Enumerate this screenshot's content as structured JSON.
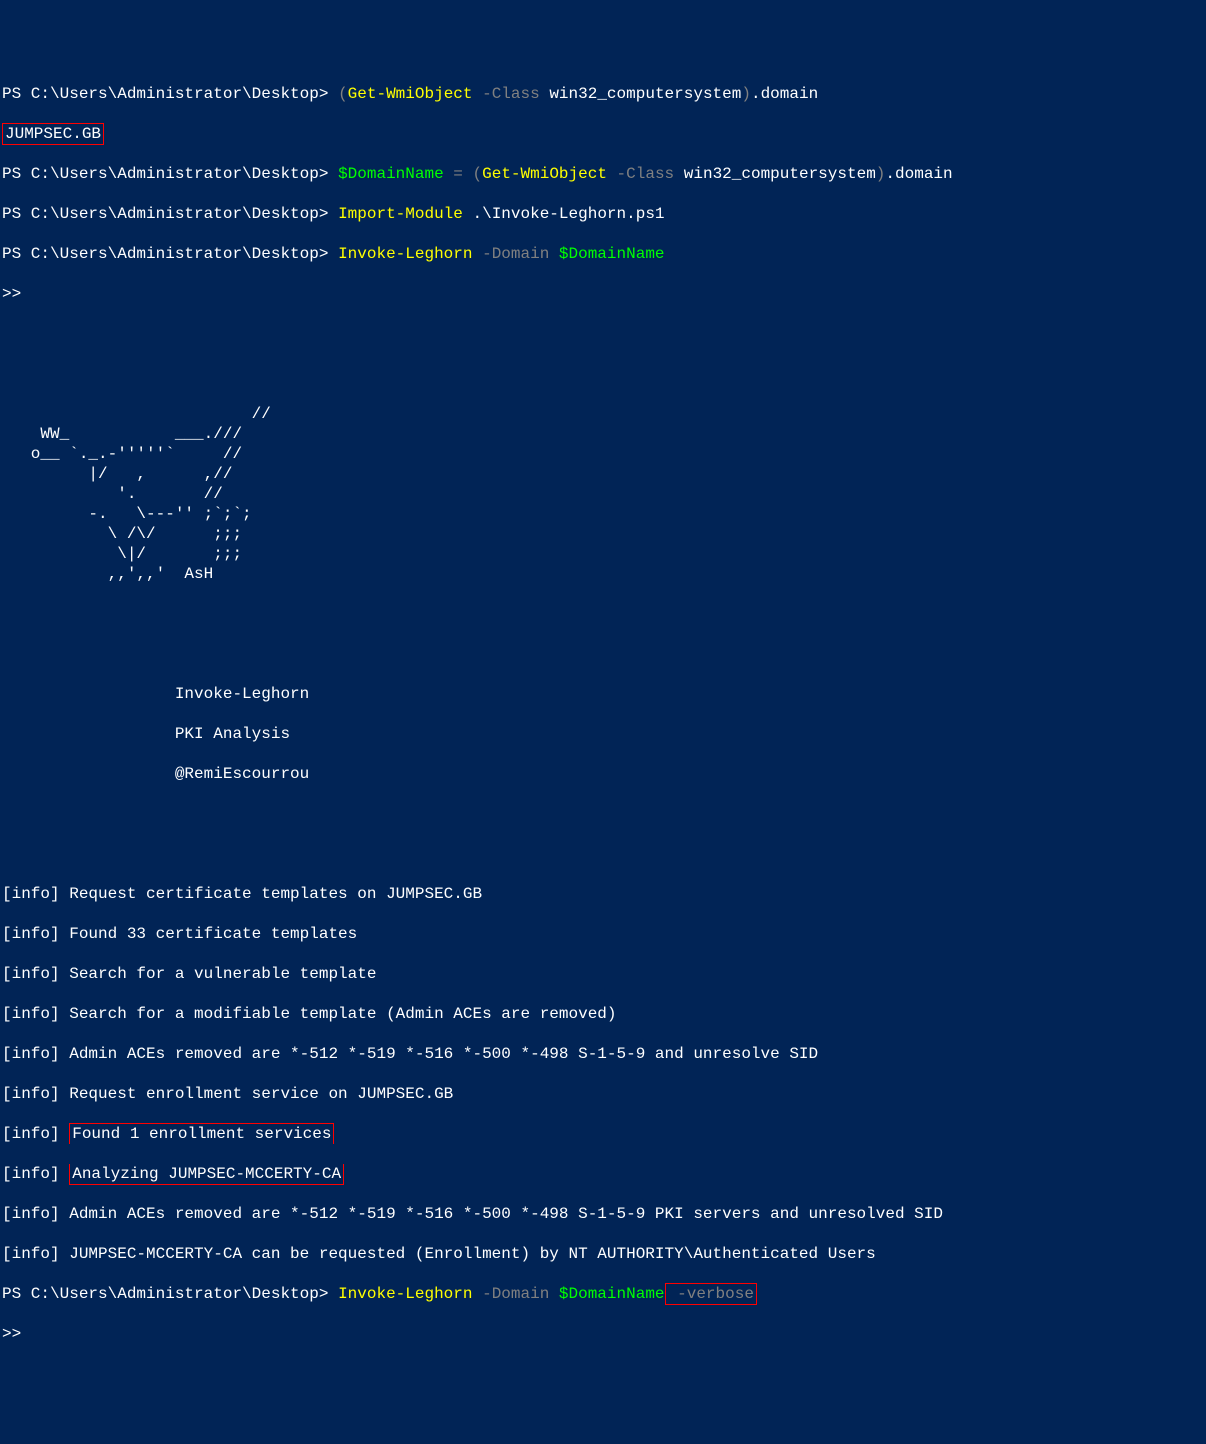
{
  "prompt": "PS C:\\Users\\Administrator\\Desktop>",
  "cmd1": {
    "paren_open": "(",
    "cmdlet": "Get-WmiObject",
    "param_flag": " -Class",
    "param_val": " win32_computersystem",
    "paren_close": ")",
    "accessor": ".domain"
  },
  "domain_result": "JUMPSEC.GB",
  "cmd2": {
    "var": "$DomainName",
    "assign": " = ",
    "paren_open": "(",
    "cmdlet": "Get-WmiObject",
    "param_flag": " -Class",
    "param_val": " win32_computersystem",
    "paren_close": ")",
    "accessor": ".domain"
  },
  "cmd3": {
    "cmdlet": "Import-Module",
    "arg": " .\\Invoke-Leghorn.ps1"
  },
  "cmd4": {
    "cmdlet": "Invoke-Leghorn",
    "param_flag": " -Domain",
    "var": " $DomainName"
  },
  "continuation": ">>",
  "ascii_art": "                          //\n    WW_           ___.///\n   o__ `._.-'''''`     //\n         |/   ,      ,//\n            '.       //\n         -.   \\---'' ;`;`;\n           \\ /\\/      ;;;\n            \\|/       ;;;\n           ,,',,'  AsH",
  "tool_title_lines": [
    "                  Invoke-Leghorn",
    "                  PKI Analysis",
    "                  @RemiEscourrou"
  ],
  "info_lines": [
    "[info] Request certificate templates on JUMPSEC.GB",
    "[info] Found 33 certificate templates",
    "[info] Search for a vulnerable template",
    "[info] Search for a modifiable template (Admin ACEs are removed)",
    "[info] Admin ACEs removed are *-512 *-519 *-516 *-500 *-498 S-1-5-9 and unresolve SID",
    "[info] Request enrollment service on JUMPSEC.GB",
    "[info] Found 1 enrollment services",
    "[info] Analyzing JUMPSEC-MCCERTY-CA",
    "[info] Admin ACEs removed are *-512 *-519 *-516 *-500 *-498 S-1-5-9 PKI servers and unresolved SID",
    "[info] JUMPSEC-MCCERTY-CA can be requested (Enrollment) by NT AUTHORITY\\Authenticated Users"
  ],
  "info_prefix_7": "[info] ",
  "info_highlight_7_a": "Found 1 enrollment services",
  "info_highlight_7_b": "Analyzing JUMPSEC-MCCERTY-CA",
  "cmd5": {
    "cmdlet": "Invoke-Leghorn",
    "param_flag": " -Domain",
    "var": " $DomainName",
    "verbose": " -verbose"
  }
}
